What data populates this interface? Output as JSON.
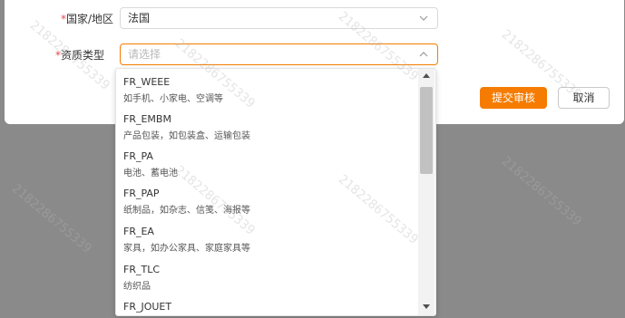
{
  "form": {
    "country_label": "国家/地区",
    "country_value": "法国",
    "qual_label": "资质类型",
    "qual_placeholder": "请选择",
    "required_mark": "*"
  },
  "buttons": {
    "submit": "提交审核",
    "cancel": "取消"
  },
  "dropdown": {
    "options": [
      {
        "title": "FR_WEEE",
        "desc": "如手机、小家电、空调等"
      },
      {
        "title": "FR_EMBM",
        "desc": "产品包装，如包装盒、运输包装"
      },
      {
        "title": "FR_PA",
        "desc": "电池、蓄电池"
      },
      {
        "title": "FR_PAP",
        "desc": "纸制品，如杂志、信笺、海报等"
      },
      {
        "title": "FR_EA",
        "desc": "家具，如办公家具、家庭家具等"
      },
      {
        "title": "FR_TLC",
        "desc": "纺织品"
      },
      {
        "title": "FR_JOUET",
        "desc": ""
      }
    ]
  },
  "watermark": "2182286755339",
  "colors": {
    "primary": "#f57c00",
    "required": "#e5484d",
    "overlay": "#8a8a8a"
  },
  "icons": [
    "chevron-down-icon",
    "chevron-up-icon",
    "scroll-up-arrow-icon",
    "scroll-down-arrow-icon"
  ]
}
